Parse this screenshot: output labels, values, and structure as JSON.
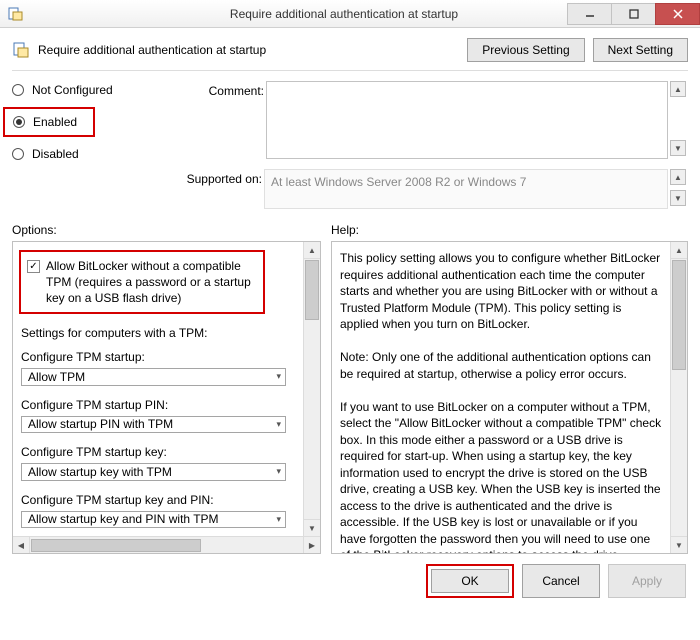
{
  "window": {
    "title": "Require additional authentication at startup"
  },
  "header": {
    "title": "Require additional authentication at startup",
    "prev_btn": "Previous Setting",
    "next_btn": "Next Setting"
  },
  "labels": {
    "comment": "Comment:",
    "supported_on": "Supported on:",
    "options": "Options:",
    "help": "Help:"
  },
  "state": {
    "not_configured": "Not Configured",
    "enabled": "Enabled",
    "disabled": "Disabled",
    "selected": "enabled"
  },
  "comment_value": "",
  "supported_on_value": "At least Windows Server 2008 R2 or Windows 7",
  "options": {
    "allow_no_tpm": {
      "label": "Allow BitLocker without a compatible TPM (requires a password or a startup key on a USB flash drive)",
      "checked": true
    },
    "section_tpm": "Settings for computers with a TPM:",
    "cfg_startup": {
      "label": "Configure TPM startup:",
      "value": "Allow TPM"
    },
    "cfg_pin": {
      "label": "Configure TPM startup PIN:",
      "value": "Allow startup PIN with TPM"
    },
    "cfg_key": {
      "label": "Configure TPM startup key:",
      "value": "Allow startup key with TPM"
    },
    "cfg_key_pin": {
      "label": "Configure TPM startup key and PIN:",
      "value": "Allow startup key and PIN with TPM"
    }
  },
  "help_text": "This policy setting allows you to configure whether BitLocker requires additional authentication each time the computer starts and whether you are using BitLocker with or without a Trusted Platform Module (TPM). This policy setting is applied when you turn on BitLocker.\n\nNote: Only one of the additional authentication options can be required at startup, otherwise a policy error occurs.\n\nIf you want to use BitLocker on a computer without a TPM, select the \"Allow BitLocker without a compatible TPM\" check box. In this mode either a password or a USB drive is required for start-up. When using a startup key, the key information used to encrypt the drive is stored on the USB drive, creating a USB key. When the USB key is inserted the access to the drive is authenticated and the drive is accessible. If the USB key is lost or unavailable or if you have forgotten the password then you will need to use one of the BitLocker recovery options to access the drive.\n\nOn a computer with a compatible TPM, four types of",
  "footer": {
    "ok": "OK",
    "cancel": "Cancel",
    "apply": "Apply"
  }
}
